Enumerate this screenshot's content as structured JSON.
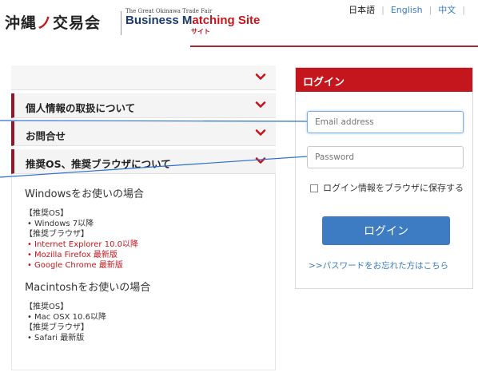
{
  "header": {
    "logo_kanji": "沖縄",
    "logo_kanji_tail": "交易会",
    "logo_subtitle": "The Great Okinawa Trade Fair",
    "logo_title_prefix": "Business M",
    "logo_title_accent": "atching Site",
    "logo_site": "サイト",
    "lang": {
      "japanese": "日本語",
      "english": "English",
      "chinese": "中文"
    }
  },
  "accordion": {
    "items": [
      {
        "label": ""
      },
      {
        "label": "個人情報の取扱について"
      },
      {
        "label": "お問合せ"
      },
      {
        "label": "推奨OS、推奨ブラウザについて"
      }
    ],
    "body": {
      "windows_title": "Windowsをお使いの場合",
      "win_os_heading": "【推奨OS】",
      "win_os": [
        "Windows 7以降"
      ],
      "win_browser_heading": "【推奨ブラウザ】",
      "win_browsers": [
        "Internet Explorer 10.0以降",
        "Mozilla Firefox 最新版",
        "Google Chrome 最新版"
      ],
      "mac_title": "Macintoshをお使いの場合",
      "mac_os_heading": "【推奨OS】",
      "mac_os": [
        "Mac OSX 10.6以降"
      ],
      "mac_browser_heading": "【推奨ブラウザ】",
      "mac_browsers": [
        "Safari 最新版"
      ]
    }
  },
  "login": {
    "title": "ログイン",
    "email_placeholder": "Email address",
    "password_placeholder": "Password",
    "remember_label": "ログイン情報をブラウザに保存する",
    "button_label": "ログイン",
    "forgot_link": ">>パスワードをお忘れた方はこちら"
  },
  "colors": {
    "brand_red": "#c4161c",
    "accordion_accent": "#8b1a2b",
    "button_blue": "#3d7cc2",
    "link_blue": "#3a7bbf",
    "annotation_line": "#2f6fd0"
  },
  "icons": {
    "accordion_toggle": "chevron-down-icon"
  }
}
